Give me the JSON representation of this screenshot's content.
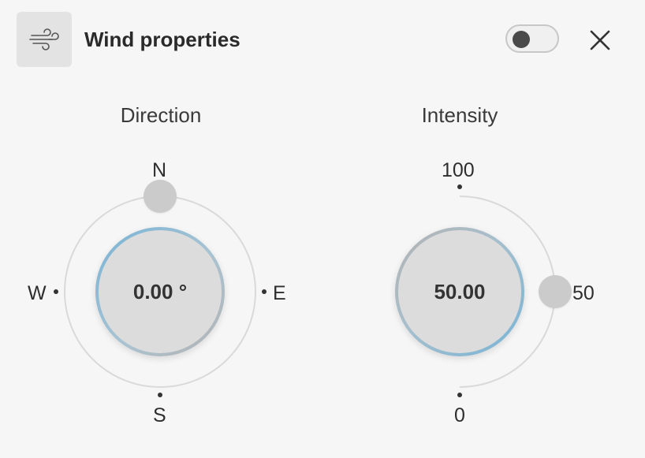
{
  "header": {
    "title": "Wind properties",
    "icon": "wind-icon",
    "toggle_on": false,
    "close_icon": "close-icon"
  },
  "direction": {
    "label": "Direction",
    "value_text": "0.00 °",
    "value": 0.0,
    "compass": {
      "north": "N",
      "east": "E",
      "south": "S",
      "west": "W"
    }
  },
  "intensity": {
    "label": "Intensity",
    "value_text": "50.00",
    "value": 50.0,
    "scale": {
      "max": "100",
      "mid": "50",
      "min": "0"
    }
  },
  "colors": {
    "accent_ring": "#78b4d6",
    "handle": "#cbcbcb",
    "track": "#d9d9d9"
  }
}
